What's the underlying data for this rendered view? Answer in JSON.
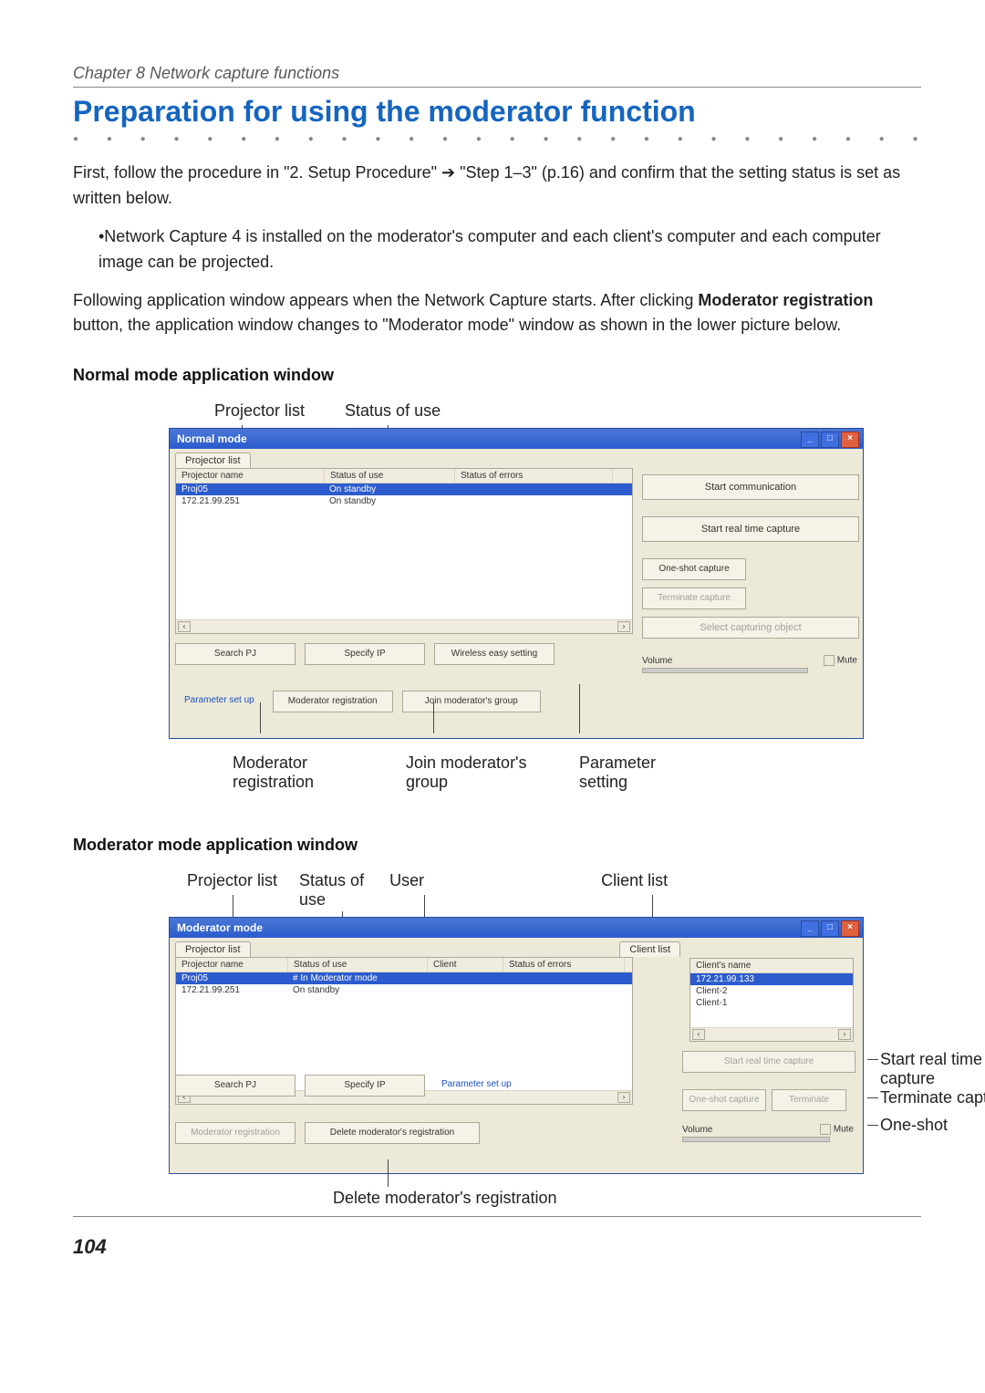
{
  "chapter": "Chapter 8 Network capture functions",
  "heading": "Preparation for using the moderator function",
  "para1": "First, follow the procedure in \"2. Setup Procedure\" ➔ \"Step 1–3\" (p.16) and confirm that the setting status is set as written below.",
  "para1_bullet": "•Network Capture 4 is installed on the moderator's computer and each client's computer and each computer image can be projected.",
  "para2_a": "Following application window appears when the Network Capture starts. After clicking ",
  "para2_bold": "Moderator registration",
  "para2_b": " button, the application window changes to \"Moderator mode\" window as shown in the lower picture below.",
  "sub1": "Normal mode application window",
  "sub2": "Moderator mode application window",
  "callouts_top_normal": {
    "projector_list": "Projector list",
    "status_of_use": "Status of use"
  },
  "callouts_below_normal": {
    "moderator_registration": "Moderator\nregistration",
    "join_group": "Join moderator's\ngroup",
    "parameter_setting": "Parameter\nsetting"
  },
  "callouts_top_moderator": {
    "projector_list": "Projector list",
    "status_of_use": "Status of\nuse",
    "user": "User",
    "client_list": "Client list"
  },
  "callouts_below_moderator": {
    "delete_reg": "Delete moderator's registration"
  },
  "side_labels": {
    "start_real_time": "Start real time\ncapture",
    "terminate_capture": "Terminate capture",
    "one_shot": "One-shot"
  },
  "normal_window": {
    "title": "Normal mode",
    "tab": "Projector list",
    "cols": {
      "name": "Projector name",
      "status_use": "Status of use",
      "status_err": "Status of errors"
    },
    "rows": [
      {
        "name": "Proj05",
        "status": "On standby",
        "sel": true
      },
      {
        "name": "172.21.99.251",
        "status": "On standby",
        "sel": false
      }
    ],
    "buttons": {
      "start_comm": "Start communication",
      "start_rt": "Start real time capture",
      "one_shot": "One-shot capture",
      "terminate": "Terminate capture",
      "select_obj": "Select capturing object",
      "volume_label": "Volume",
      "mute": "Mute",
      "search_pj": "Search PJ",
      "specify_ip": "Specify IP",
      "wireless_easy": "Wireless easy setting",
      "moderator_reg": "Moderator registration",
      "join_group": "Join moderator's group",
      "param_setup": "Parameter set up"
    }
  },
  "moderator_window": {
    "title": "Moderator mode",
    "tab": "Projector list",
    "cols": {
      "name": "Projector name",
      "status_use": "Status of use",
      "client": "Client",
      "status_err": "Status of errors"
    },
    "rows": [
      {
        "name": "Proj05",
        "status": "# In Moderator mode",
        "sel": true
      },
      {
        "name": "172.21.99.251",
        "status": "On standby",
        "sel": false
      }
    ],
    "client_tab": "Client list",
    "client_col": "Client's name",
    "clients": [
      {
        "name": "172.21.99.133",
        "sel": true
      },
      {
        "name": "Client-2",
        "sel": false
      },
      {
        "name": "Client-1",
        "sel": false
      }
    ],
    "buttons": {
      "start_rt": "Start real time capture",
      "one_shot": "One-shot capture",
      "terminate": "Terminate",
      "volume_label": "Volume",
      "mute": "Mute",
      "search_pj": "Search PJ",
      "specify_ip": "Specify IP",
      "moderator_reg": "Moderator registration",
      "delete_reg": "Delete moderator's registration",
      "param_setup": "Parameter set up"
    }
  },
  "page_number": "104"
}
